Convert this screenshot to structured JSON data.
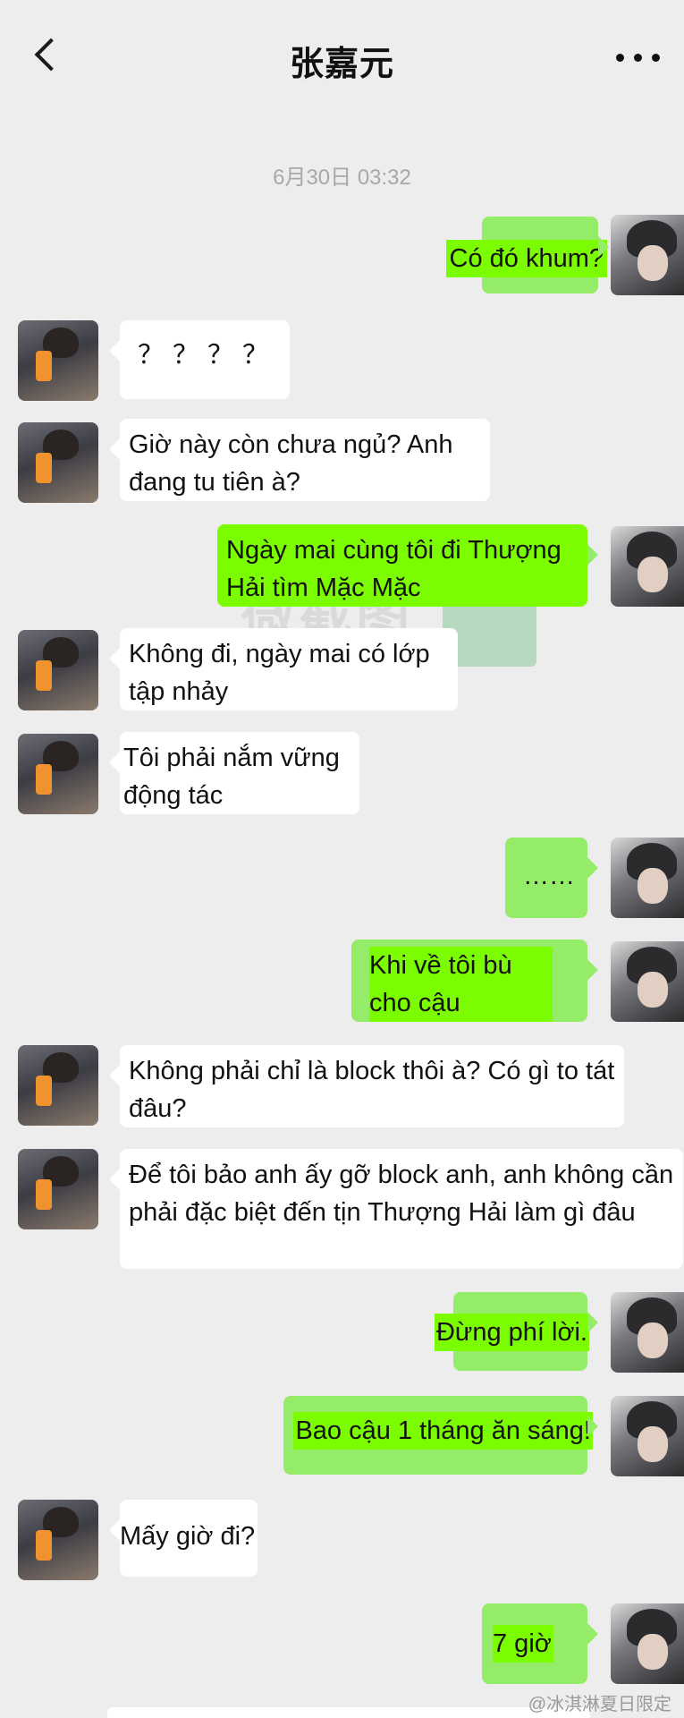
{
  "header": {
    "title": "张嘉元"
  },
  "timestamp": "6月30日 03:32",
  "messages": [
    {
      "side": "right",
      "text": "Có đó khum?"
    },
    {
      "side": "left",
      "text": "？？？？"
    },
    {
      "side": "left",
      "text": "Giờ này còn chưa ngủ? Anh đang tu tiên à?"
    },
    {
      "side": "right",
      "text": "Ngày mai cùng tôi đi Thượng Hải tìm Mặc Mặc"
    },
    {
      "side": "left",
      "text": "Không đi, ngày mai có lớp tập nhảy"
    },
    {
      "side": "left",
      "text": "Tôi phải nắm vững động tác"
    },
    {
      "side": "right",
      "text": "……"
    },
    {
      "side": "right",
      "text": "Khi về tôi bù cho cậu"
    },
    {
      "side": "left",
      "text": "Không phải chỉ là block thôi à? Có gì to tát đâu?"
    },
    {
      "side": "left",
      "text": "Để tôi bảo anh ấy gỡ block anh, anh không cần phải đặc biệt đến tịn Thượng Hải làm gì đâu"
    },
    {
      "side": "right",
      "text": "Đừng phí lời."
    },
    {
      "side": "right",
      "text": "Bao cậu 1 tháng ăn sáng!"
    },
    {
      "side": "left",
      "text": "Mấy giờ đi?"
    },
    {
      "side": "right",
      "text": "7 giờ"
    }
  ],
  "watermark": "微截图",
  "credit": "@冰淇淋夏日限定"
}
